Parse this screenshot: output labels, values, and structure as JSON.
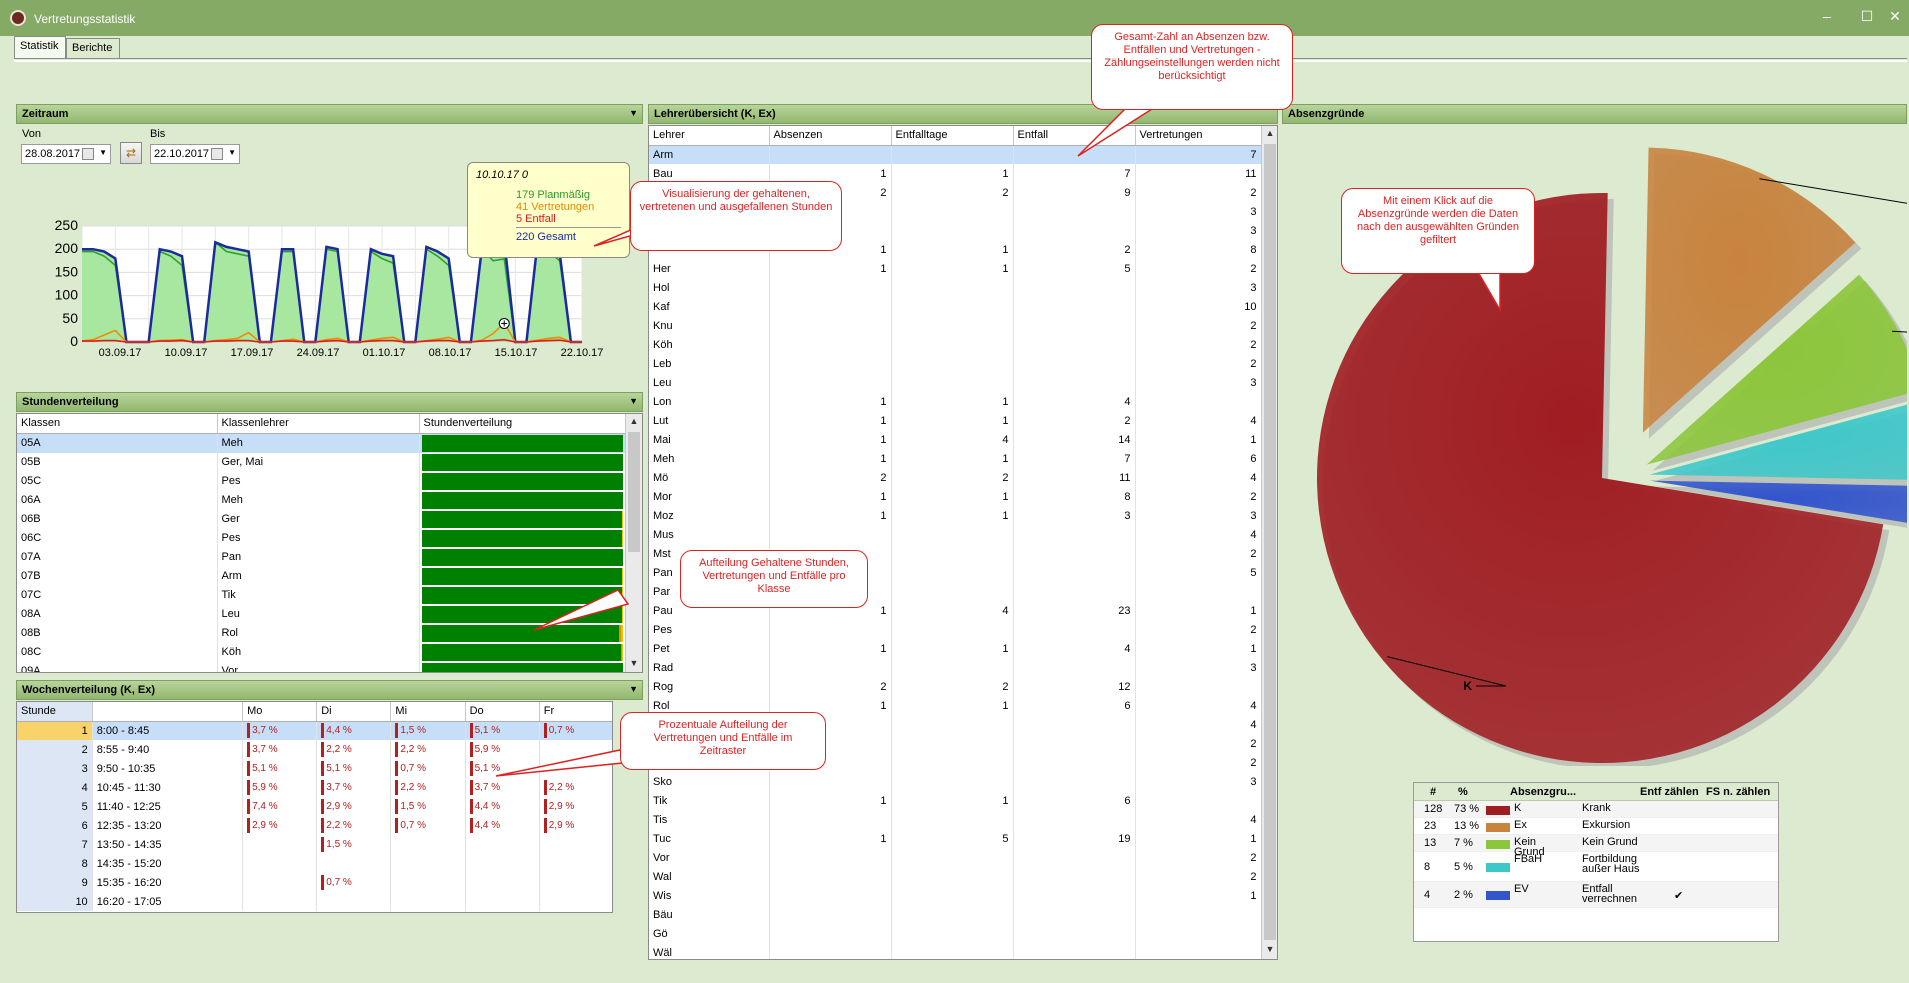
{
  "window": {
    "title": "Vertretungsstatistik"
  },
  "tabs": [
    {
      "label": "Statistik"
    },
    {
      "label": "Berichte"
    }
  ],
  "zeitraum": {
    "title": "Zeitraum",
    "von_label": "Von",
    "von": "28.08.2017",
    "bis_label": "Bis",
    "bis": "22.10.2017"
  },
  "chart_data": {
    "type": "area",
    "ylim": [
      0,
      250
    ],
    "yticks": [
      0,
      50,
      100,
      150,
      200,
      250
    ],
    "xticks": [
      "03.09.17",
      "10.09.17",
      "17.09.17",
      "24.09.17",
      "01.10.17",
      "08.10.17",
      "15.10.17",
      "22.10.17"
    ],
    "series": [
      {
        "name": "Planmäßig",
        "color": "#2ea02e",
        "values": [
          195,
          195,
          185,
          165,
          0,
          0,
          0,
          195,
          185,
          165,
          0,
          0,
          215,
          195,
          190,
          185,
          0,
          0,
          195,
          195,
          0,
          0,
          200,
          195,
          0,
          0,
          195,
          180,
          170,
          0,
          0,
          200,
          185,
          165,
          0,
          0,
          200,
          175,
          179,
          0,
          0,
          210,
          195,
          175,
          0,
          0
        ]
      },
      {
        "name": "Gesamt",
        "color": "#1c2aa0",
        "values": [
          200,
          200,
          195,
          180,
          0,
          0,
          0,
          200,
          195,
          185,
          0,
          0,
          215,
          205,
          200,
          195,
          0,
          0,
          200,
          200,
          0,
          0,
          205,
          200,
          0,
          0,
          200,
          190,
          185,
          0,
          0,
          205,
          195,
          180,
          0,
          0,
          205,
          195,
          220,
          0,
          0,
          215,
          200,
          190,
          0,
          0
        ]
      },
      {
        "name": "Vertretungen",
        "color": "#f08a00",
        "values": [
          2,
          5,
          15,
          25,
          0,
          0,
          0,
          3,
          4,
          5,
          0,
          0,
          3,
          5,
          8,
          20,
          0,
          0,
          3,
          6,
          0,
          0,
          5,
          8,
          0,
          0,
          4,
          8,
          10,
          0,
          0,
          3,
          6,
          10,
          0,
          0,
          4,
          18,
          41,
          0,
          0,
          4,
          8,
          10,
          0,
          0
        ]
      },
      {
        "name": "Entfall",
        "color": "#e21a1a",
        "values": [
          2,
          2,
          3,
          3,
          0,
          0,
          0,
          2,
          2,
          3,
          0,
          0,
          2,
          2,
          3,
          3,
          0,
          0,
          2,
          2,
          0,
          0,
          2,
          3,
          0,
          0,
          2,
          3,
          3,
          0,
          0,
          2,
          3,
          3,
          0,
          0,
          2,
          3,
          5,
          0,
          0,
          2,
          3,
          4,
          0,
          0
        ]
      }
    ]
  },
  "tooltip": {
    "date": "10.10.17 0",
    "plan": "179 Planmäßig",
    "vert": "41 Vertretungen",
    "entf": "5 Entfall",
    "ges": "220 Gesamt"
  },
  "stundenverteilung": {
    "title": "Stundenverteilung",
    "headers": [
      "Klassen",
      "Klassenlehrer",
      "Stundenverteilung"
    ],
    "rows": [
      {
        "k": "05A",
        "l": "Meh",
        "y": 0,
        "o": 0
      },
      {
        "k": "05B",
        "l": "Ger, Mai",
        "y": 0,
        "o": 0
      },
      {
        "k": "05C",
        "l": "Pes",
        "y": 0,
        "o": 0
      },
      {
        "k": "06A",
        "l": "Meh",
        "y": 0,
        "o": 0
      },
      {
        "k": "06B",
        "l": "Ger",
        "y": 1,
        "o": 0
      },
      {
        "k": "06C",
        "l": "Pes",
        "y": 1,
        "o": 0
      },
      {
        "k": "07A",
        "l": "Pan",
        "y": 0,
        "o": 0
      },
      {
        "k": "07B",
        "l": "Arm",
        "y": 1,
        "o": 0
      },
      {
        "k": "07C",
        "l": "Tik",
        "y": 1,
        "o": 0
      },
      {
        "k": "08A",
        "l": "Leu",
        "y": 1,
        "o": 0
      },
      {
        "k": "08B",
        "l": "Rol",
        "y": 2,
        "o": 2
      },
      {
        "k": "08C",
        "l": "Köh",
        "y": 1,
        "o": 1
      },
      {
        "k": "09A",
        "l": "Vor",
        "y": 0,
        "o": 0
      }
    ]
  },
  "wochenverteilung": {
    "title": "Wochenverteilung (K, Ex)",
    "headers": [
      "Stunde",
      "",
      "Mo",
      "Di",
      "Mi",
      "Do",
      "Fr"
    ],
    "rows": [
      {
        "n": "1",
        "t": "8:00 - 8:45",
        "d": [
          "3,7 %",
          "4,4 %",
          "1,5 %",
          "5,1 %",
          "0,7 %"
        ]
      },
      {
        "n": "2",
        "t": "8:55 - 9:40",
        "d": [
          "3,7 %",
          "2,2 %",
          "2,2 %",
          "5,9 %",
          ""
        ]
      },
      {
        "n": "3",
        "t": "9:50 - 10:35",
        "d": [
          "5,1 %",
          "5,1 %",
          "0,7 %",
          "5,1 %",
          ""
        ]
      },
      {
        "n": "4",
        "t": "10:45 - 11:30",
        "d": [
          "5,9 %",
          "3,7 %",
          "2,2 %",
          "3,7 %",
          "2,2 %"
        ]
      },
      {
        "n": "5",
        "t": "11:40 - 12:25",
        "d": [
          "7,4 %",
          "2,9 %",
          "1,5 %",
          "4,4 %",
          "2,9 %"
        ]
      },
      {
        "n": "6",
        "t": "12:35 - 13:20",
        "d": [
          "2,9 %",
          "2,2 %",
          "0,7 %",
          "4,4 %",
          "2,9 %"
        ]
      },
      {
        "n": "7",
        "t": "13:50 - 14:35",
        "d": [
          "",
          "1,5 %",
          "",
          "",
          ""
        ]
      },
      {
        "n": "8",
        "t": "14:35 - 15:20",
        "d": [
          "",
          "",
          "",
          "",
          ""
        ]
      },
      {
        "n": "9",
        "t": "15:35 - 16:20",
        "d": [
          "",
          "0,7 %",
          "",
          "",
          ""
        ]
      },
      {
        "n": "10",
        "t": "16:20 - 17:05",
        "d": [
          "",
          "",
          "",
          "",
          ""
        ]
      }
    ]
  },
  "lehrer": {
    "title": "Lehrerübersicht (K, Ex)",
    "headers": [
      "Lehrer",
      "Absenzen",
      "Entfalltage",
      "Entfall",
      "Vertretungen"
    ],
    "rows": [
      [
        "Arm",
        "",
        "",
        "",
        "7"
      ],
      [
        "Bau",
        "1",
        "1",
        "7",
        "11"
      ],
      [
        "",
        "2",
        "2",
        "9",
        "2"
      ],
      [
        "",
        "",
        "",
        "",
        "3"
      ],
      [
        "",
        "",
        "",
        "",
        "3"
      ],
      [
        "",
        "1",
        "1",
        "2",
        "8"
      ],
      [
        "Her",
        "1",
        "1",
        "5",
        "2"
      ],
      [
        "Hol",
        "",
        "",
        "",
        "3"
      ],
      [
        "Kaf",
        "",
        "",
        "",
        "10"
      ],
      [
        "Knu",
        "",
        "",
        "",
        "2"
      ],
      [
        "Köh",
        "",
        "",
        "",
        "2"
      ],
      [
        "Leb",
        "",
        "",
        "",
        "2"
      ],
      [
        "Leu",
        "",
        "",
        "",
        "3"
      ],
      [
        "Lon",
        "1",
        "1",
        "4",
        ""
      ],
      [
        "Lut",
        "1",
        "1",
        "2",
        "4"
      ],
      [
        "Mai",
        "1",
        "4",
        "14",
        "1"
      ],
      [
        "Meh",
        "1",
        "1",
        "7",
        "6"
      ],
      [
        "Mö",
        "2",
        "2",
        "11",
        "4"
      ],
      [
        "Mor",
        "1",
        "1",
        "8",
        "2"
      ],
      [
        "Moz",
        "1",
        "1",
        "3",
        "3"
      ],
      [
        "Mus",
        "",
        "",
        "",
        "4"
      ],
      [
        "Mst",
        "",
        "",
        "",
        "2"
      ],
      [
        "Pan",
        "",
        "",
        "",
        "5"
      ],
      [
        "Par",
        "",
        "",
        "",
        ""
      ],
      [
        "Pau",
        "1",
        "4",
        "23",
        "1"
      ],
      [
        "Pes",
        "",
        "",
        "",
        "2"
      ],
      [
        "Pet",
        "1",
        "1",
        "4",
        "1"
      ],
      [
        "Rad",
        "",
        "",
        "",
        "3"
      ],
      [
        "Rog",
        "2",
        "2",
        "12",
        ""
      ],
      [
        "Rol",
        "1",
        "1",
        "6",
        "4"
      ],
      [
        "",
        "",
        "",
        "",
        "4"
      ],
      [
        "",
        "",
        "",
        "",
        "2"
      ],
      [
        "",
        "",
        "",
        "",
        "2"
      ],
      [
        "Sko",
        "",
        "",
        "",
        "3"
      ],
      [
        "Tik",
        "1",
        "1",
        "6",
        ""
      ],
      [
        "Tis",
        "",
        "",
        "",
        "4"
      ],
      [
        "Tuc",
        "1",
        "5",
        "19",
        "1"
      ],
      [
        "Vor",
        "",
        "",
        "",
        "2"
      ],
      [
        "Wal",
        "",
        "",
        "",
        "2"
      ],
      [
        "Wis",
        "",
        "",
        "",
        "1"
      ],
      [
        "Bäu",
        "",
        "",
        "",
        ""
      ],
      [
        "Gö",
        "",
        "",
        "",
        ""
      ],
      [
        "Wäl",
        "",
        "",
        "",
        ""
      ]
    ]
  },
  "absenz": {
    "title": "Absenzgründe",
    "pie": [
      {
        "label": "K",
        "value": 128,
        "color": "#a01d22"
      },
      {
        "label": "Ex",
        "value": 23,
        "color": "#c8833e"
      },
      {
        "label": "Kein Grund",
        "value": 13,
        "color": "#8cc63a"
      },
      {
        "label": "FBaH",
        "value": 8,
        "color": "#3ec7c9"
      },
      {
        "label": "EV",
        "value": 4,
        "color": "#3355cc"
      }
    ],
    "legend_headers": [
      "#",
      "%",
      "Absenzgru...",
      "Entf zählen",
      "FS n. zählen"
    ],
    "legend_rows": [
      {
        "n": "128",
        "p": "73 %",
        "c": "#a01d22",
        "code": "K",
        "desc": "Krank",
        "check": ""
      },
      {
        "n": "23",
        "p": "13 %",
        "c": "#c8833e",
        "code": "Ex",
        "desc": "Exkursion",
        "check": ""
      },
      {
        "n": "13",
        "p": "7 %",
        "c": "#8cc63a",
        "code": "Kein Grund",
        "desc": "Kein Grund",
        "check": ""
      },
      {
        "n": "8",
        "p": "5 %",
        "c": "#3ec7c9",
        "code": "FBaH",
        "desc": "Fortbildung außer Haus",
        "check": ""
      },
      {
        "n": "4",
        "p": "2 %",
        "c": "#3355cc",
        "code": "EV",
        "desc": "Entfall verrechnen",
        "check": "✔"
      }
    ]
  },
  "callouts": {
    "gesamt": "Gesamt-Zahl an Absenzen bzw. Entfällen und Vertretungen - Zählungseinstellungen werden nicht berücksichtigt",
    "visual": "Visualisierung der gehaltenen, vertretenen und ausgefallenen Stunden",
    "klick": "Mit einem Klick auf die Absenzgründe werden die Daten nach den ausgewählten Gründen gefiltert",
    "aufteilung": "Aufteilung Gehaltene Stunden, Vertretungen und Entfälle pro Klasse",
    "prozent": "Prozentuale Aufteilung der Vertretungen und Entfälle im Zeitraster"
  }
}
